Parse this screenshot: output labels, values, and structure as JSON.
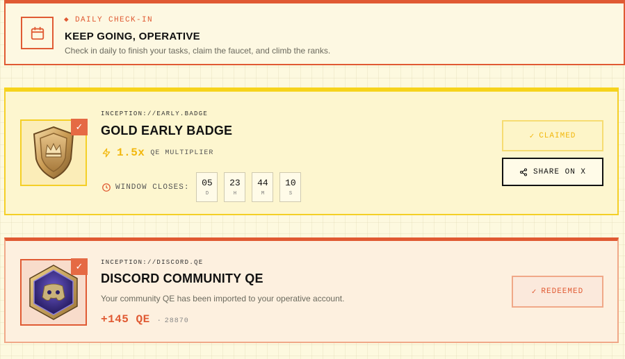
{
  "checkin": {
    "eyebrow_icon": "◆",
    "eyebrow": "DAILY CHECK-IN",
    "title": "KEEP GOING, OPERATIVE",
    "description": "Check in daily to finish your tasks, claim the faucet, and climb the ranks.",
    "icon": "calendar-icon"
  },
  "gold_card": {
    "path": "INCEPTION://EARLY.BADGE",
    "title": "GOLD EARLY BADGE",
    "multiplier_value": "1.5x",
    "multiplier_label": "QE MULTIPLIER",
    "window_label": "WINDOW CLOSES:",
    "countdown": [
      {
        "value": "05",
        "unit": "D"
      },
      {
        "value": "23",
        "unit": "H"
      },
      {
        "value": "44",
        "unit": "M"
      },
      {
        "value": "10",
        "unit": "S"
      }
    ],
    "claimed_label": "CLAIMED",
    "share_label": "SHARE ON X",
    "check_mark": "✓"
  },
  "discord_card": {
    "path": "INCEPTION://DISCORD.QE",
    "title": "DISCORD COMMUNITY QE",
    "description": "Your community QE has been imported to your operative account.",
    "amount": "+145 QE",
    "separator": "·",
    "id_value": "28870",
    "redeemed_label": "REDEEMED",
    "check_mark": "✓"
  },
  "colors": {
    "accent": "#e05a33",
    "gold": "#f2b70c",
    "background": "#fdf9df"
  }
}
